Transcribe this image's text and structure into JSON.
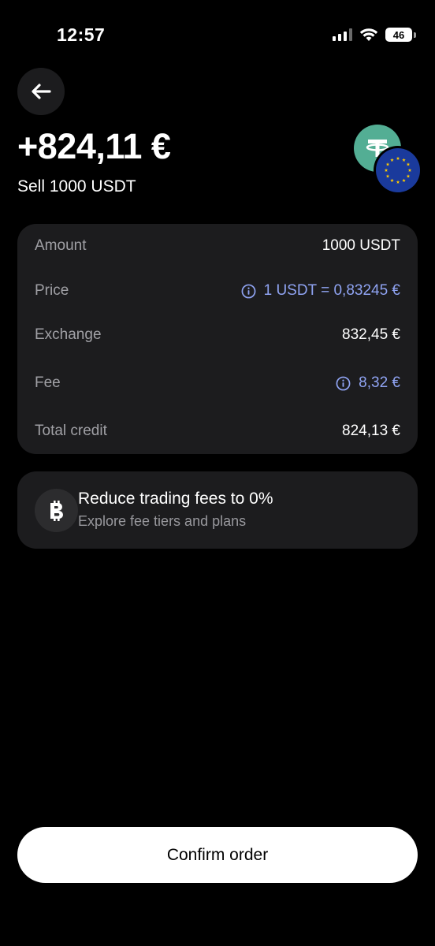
{
  "status_bar": {
    "time": "12:57",
    "battery": "46",
    "icons": [
      "signal-icon",
      "wifi-icon",
      "battery-icon"
    ]
  },
  "header": {
    "back_icon": "arrow-left-icon",
    "amount": "+824,11 €",
    "subtitle": "Sell 1000 USDT",
    "token_icons": [
      "tether-icon",
      "eu-flag-icon"
    ]
  },
  "details": {
    "rows": [
      {
        "label": "Amount",
        "value": "1000 USDT",
        "has_info": false
      },
      {
        "label": "Price",
        "value": "1 USDT = 0,83245 €",
        "has_info": true
      },
      {
        "label": "Exchange",
        "value": "832,45 €",
        "has_info": false
      },
      {
        "label": "Fee",
        "value": "8,32 €",
        "has_info": true
      },
      {
        "label": "Total credit",
        "value": "824,13 €",
        "has_info": false
      }
    ]
  },
  "promo": {
    "icon": "bitcoin-icon",
    "title": "Reduce trading fees to 0%",
    "subtitle": "Explore fee tiers and plans"
  },
  "confirm_label": "Confirm order",
  "colors": {
    "background": "#000000",
    "card": "#1c1c1e",
    "accent_link": "#8fa3f2",
    "tether": "#53ae94",
    "eu_blue": "#1a3a9c",
    "eu_star": "#ffcc00"
  }
}
